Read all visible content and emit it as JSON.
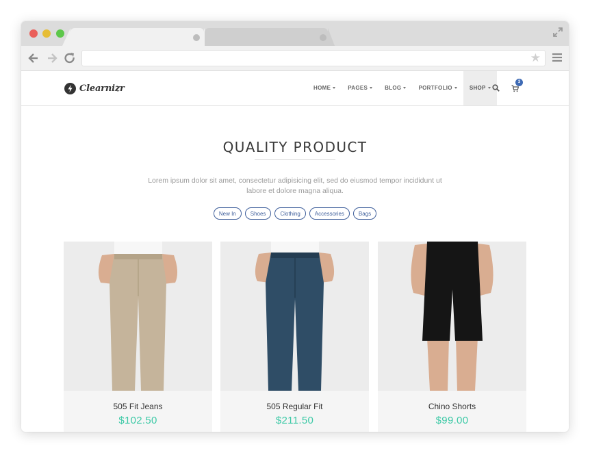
{
  "browser": {
    "url": "",
    "tabs": [
      {
        "label": ""
      },
      {
        "label": ""
      }
    ]
  },
  "site": {
    "logo_text": "Clearnizr",
    "nav": [
      {
        "label": "HOME"
      },
      {
        "label": "PAGES"
      },
      {
        "label": "BLOG"
      },
      {
        "label": "PORTFOLIO"
      },
      {
        "label": "SHOP",
        "active": true
      }
    ],
    "cart_count": "3",
    "icons": {
      "search": "search-icon",
      "cart": "cart-icon",
      "logo": "bolt-icon"
    }
  },
  "hero": {
    "title": "QUALITY PRODUCT",
    "description": "Lorem ipsum dolor sit amet, consectetur adipisicing elit, sed do eiusmod tempor incididunt ut labore et dolore magna aliqua."
  },
  "filters": [
    "New In",
    "Shoes",
    "Clothing",
    "Accessories",
    "Bags"
  ],
  "products": [
    {
      "name": "505 Fit Jeans",
      "price": "$102.50",
      "color": "#c5b49b"
    },
    {
      "name": "505 Regular Fit",
      "price": "$211.50",
      "color": "#2f4d66"
    },
    {
      "name": "Chino Shorts",
      "price": "$99.00",
      "color": "#151515"
    }
  ],
  "colors": {
    "accent_price": "#3cc9a6",
    "chip": "#3f5f9b",
    "badge": "#3f6bb5"
  }
}
